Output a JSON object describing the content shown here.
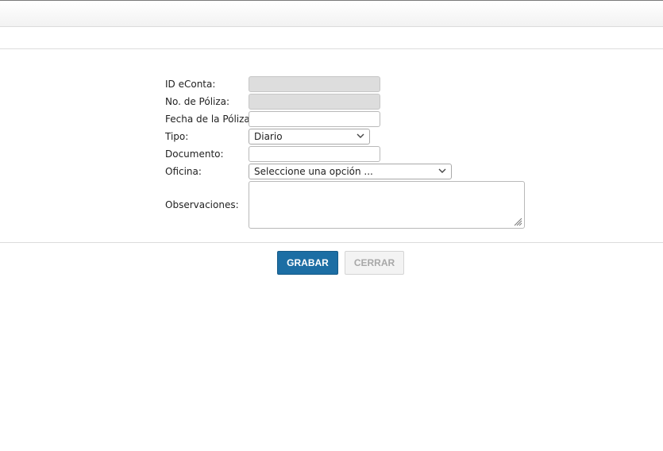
{
  "form": {
    "id_econta": {
      "label": "ID eConta:",
      "value": ""
    },
    "no_poliza": {
      "label": "No. de Póliza:",
      "value": ""
    },
    "fecha_poliza": {
      "label": "Fecha de la Póliza:",
      "value": ""
    },
    "tipo": {
      "label": "Tipo:",
      "selected": "Diario"
    },
    "documento": {
      "label": "Documento:",
      "value": ""
    },
    "oficina": {
      "label": "Oficina:",
      "selected": "Seleccione una opción ..."
    },
    "observaciones": {
      "label": "Observaciones:",
      "value": ""
    }
  },
  "actions": {
    "grabar_label": "GRABAR",
    "cerrar_label": "CERRAR"
  },
  "icons": {
    "select_arrow": "chevron-down-icon",
    "resize_grip": "resize-grip-icon"
  },
  "colors": {
    "primary_button": "#1c6ea4",
    "disabled_field": "#dddddd"
  }
}
